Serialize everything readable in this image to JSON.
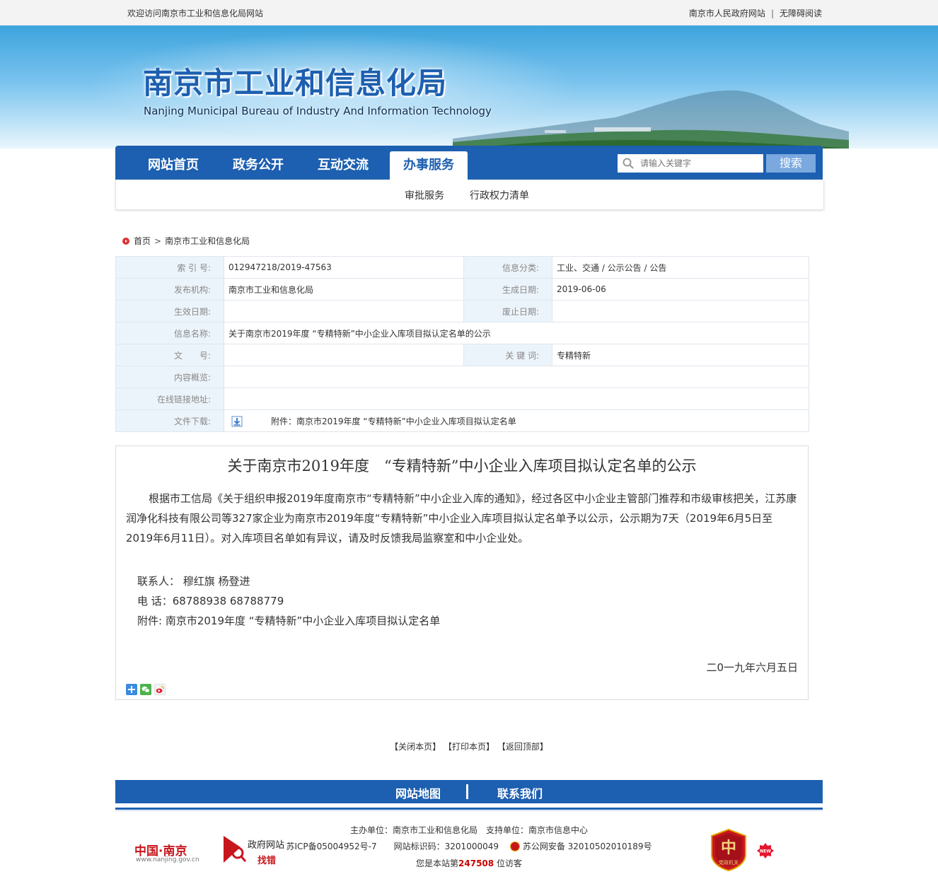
{
  "topbar": {
    "welcome": "欢迎访问南京市工业和信息化局网站",
    "gov_link": "南京市人民政府网站",
    "separator": "|",
    "accessible": "无障碍阅读"
  },
  "banner": {
    "title_cn": "南京市工业和信息化局",
    "title_en": "Nanjing Municipal Bureau of Industry And Information Technology"
  },
  "nav": {
    "items": [
      "网站首页",
      "政务公开",
      "互动交流",
      "办事服务"
    ],
    "search_placeholder": "请输入关键字",
    "search_button": "搜索"
  },
  "subnav": [
    "审批服务",
    "行政权力清单"
  ],
  "breadcrumb": {
    "home": "首页",
    "current": "南京市工业和信息化局"
  },
  "info": {
    "index_label": "索 引 号:",
    "index_value": "012947218/2019-47563",
    "category_label": "信息分类:",
    "category_value": "工业、交通 / 公示公告 / 公告",
    "publisher_label": "发布机构:",
    "publisher_value": "南京市工业和信息化局",
    "gen_date_label": "生成日期:",
    "gen_date_value": "2019-06-06",
    "effective_label": "生效日期:",
    "effective_value": "",
    "abolish_label": "废止日期:",
    "abolish_value": "",
    "name_label": "信息名称:",
    "name_value": "关于南京市2019年度 “专精特新”中小企业入库项目拟认定名单的公示",
    "docno_label": "文　　号:",
    "docno_value": "",
    "keyword_label": "关 键 词:",
    "keyword_value": "专精特新",
    "overview_label": "内容概览:",
    "overview_value": "",
    "link_label": "在线链接地址:",
    "link_value": "",
    "download_label": "文件下载:",
    "download_value": "附件：南京市2019年度 “专精特新”中小企业入库项目拟认定名单"
  },
  "article": {
    "title": "关于南京市2019年度　“专精特新”中小企业入库项目拟认定名单的公示",
    "body": "根据市工信局《关于组织申报2019年度南京市“专精特新”中小企业入库的通知》，经过各区中小企业主管部门推荐和市级审核把关，江苏康润净化科技有限公司等327家企业为南京市2019年度“专精特新”中小企业入库项目拟认定名单予以公示，公示期为7天（2019年6月5日至2019年6月11日）。对入库项目名单如有异议，请及时反馈我局监察室和中小企业处。",
    "contact": "联系人：   穆红旗     杨登进",
    "phone": "电  话：68788938  68788779",
    "attachment": "附件: 南京市2019年度 “专精特新”中小企业入库项目拟认定名单",
    "date": "二0一九年六月五日"
  },
  "actions": {
    "close": "【关闭本页】",
    "print": "【打印本页】",
    "top": "【返回顶部】"
  },
  "footer": {
    "sitemap": "网站地图",
    "contact": "联系我们",
    "host": "主办单位：南京市工业和信息化局　支持单位：南京市信息中心",
    "icp": "苏ICP备05004952号-7　　网站标识码：3201000049",
    "police": "苏公网安备 32010502010189号",
    "visitor_prefix": "您是本站第",
    "visitor_count": "247508",
    "visitor_suffix": " 位访客",
    "logo_cn": "中国·南京",
    "logo_cn_url": "www.nanjing.gov.cn",
    "gov_site": "政府网站",
    "find_error": "找错",
    "badge_text": "党政机关",
    "new_text": "NEW"
  }
}
